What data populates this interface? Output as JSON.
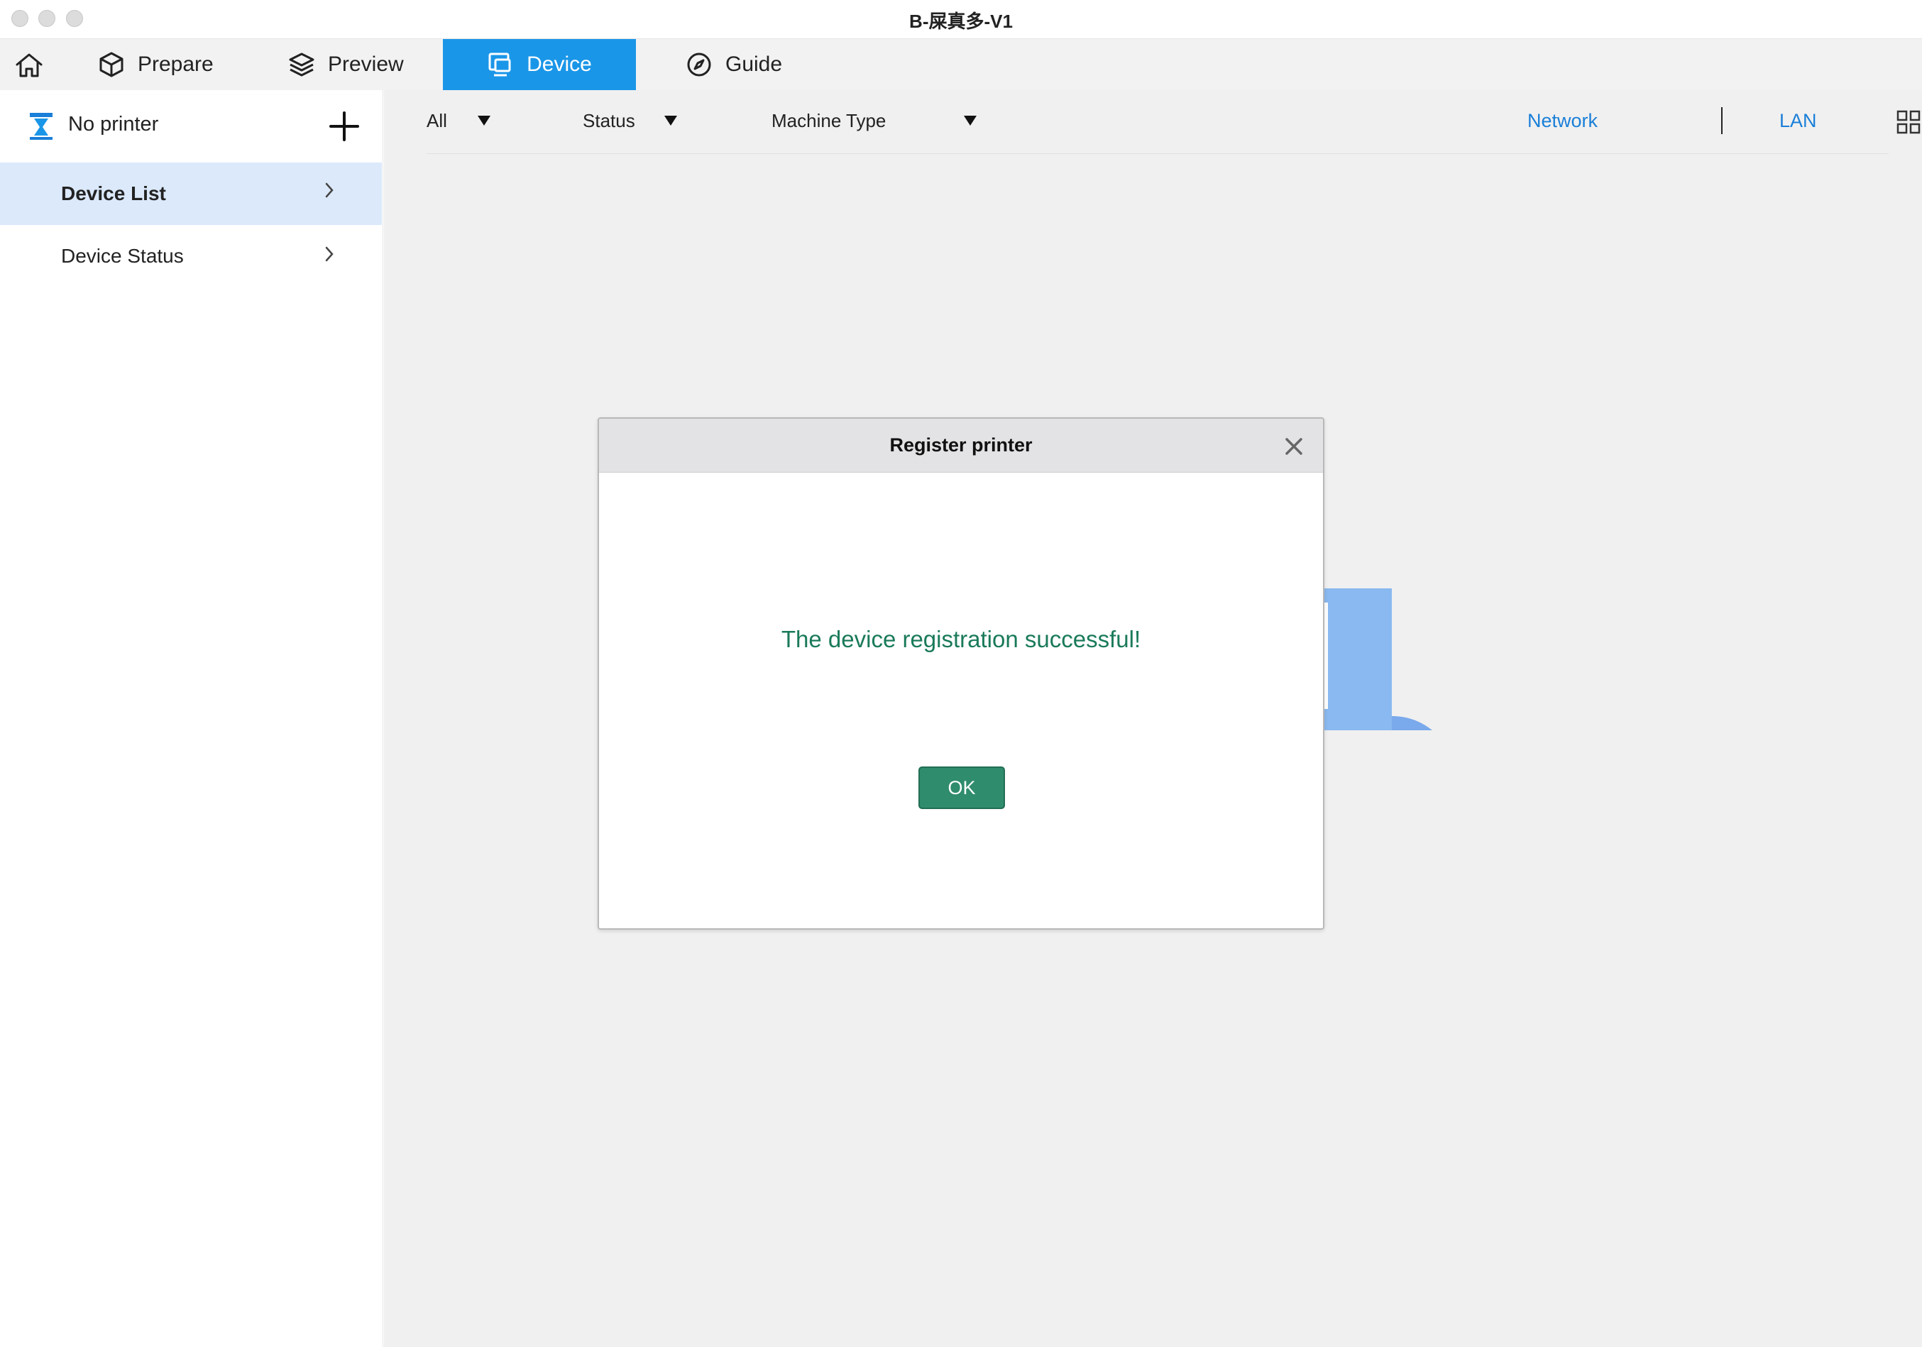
{
  "window": {
    "title": "B-屎真多-V1"
  },
  "nav": {
    "home_icon": "home-icon",
    "tabs": [
      {
        "label": "Prepare",
        "icon": "cube-icon",
        "active": false
      },
      {
        "label": "Preview",
        "icon": "layers-icon",
        "active": false
      },
      {
        "label": "Device",
        "icon": "device-icon",
        "active": true
      },
      {
        "label": "Guide",
        "icon": "compass-icon",
        "active": false
      }
    ]
  },
  "sidebar": {
    "printer_label": "No printer",
    "printer_icon": "printer-icon",
    "add_icon": "plus-icon",
    "items": [
      {
        "label": "Device List",
        "active": true
      },
      {
        "label": "Device Status",
        "active": false
      }
    ]
  },
  "filters": {
    "all": "All",
    "status": "Status",
    "machine_type": "Machine Type",
    "network": "Network",
    "lan": "LAN",
    "view_icon": "grid-view-icon"
  },
  "dialog": {
    "title": "Register printer",
    "message": "The device registration successful!",
    "ok_label": "OK",
    "close_icon": "close-icon"
  },
  "colors": {
    "accent": "#1a96e8",
    "link": "#1a7fd8",
    "success_text": "#1a7a5a",
    "ok_button": "#2f8c6c",
    "selected_item_bg": "#dbe9fb"
  }
}
